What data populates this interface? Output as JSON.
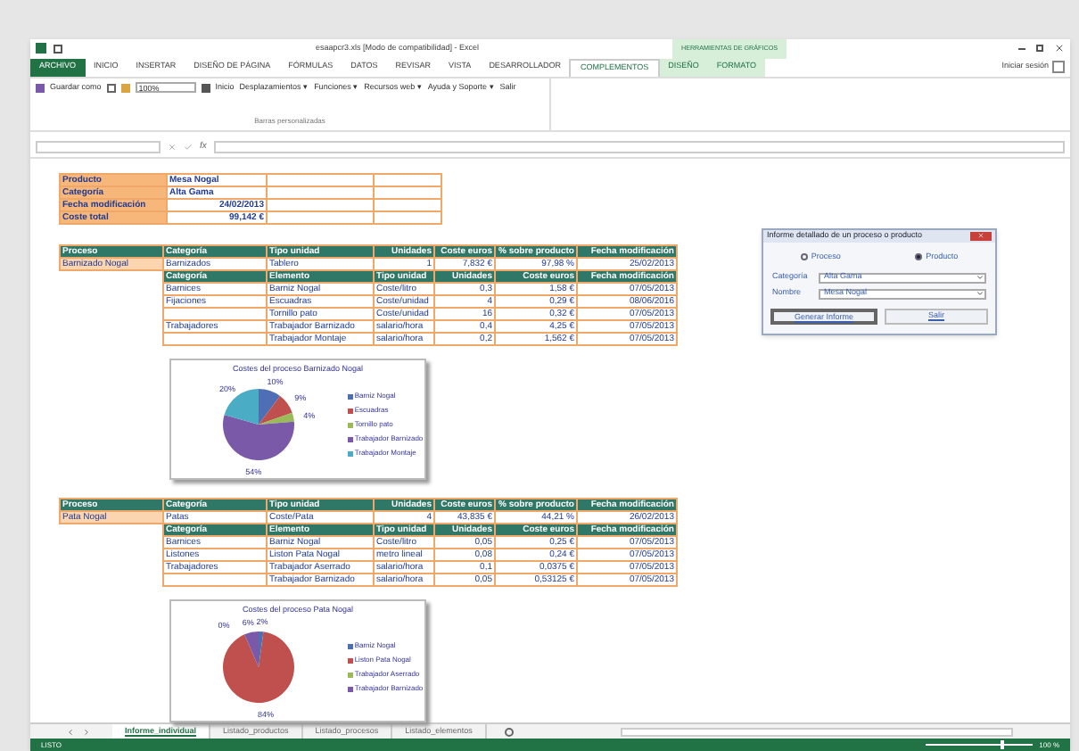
{
  "window": {
    "title": "esaapcr3.xls [Modo de compatibilidad] - Excel",
    "user": "Iniciar sesión"
  },
  "context_group": "HERRAMIENTAS DE GRÁFICOS",
  "tabs": [
    {
      "label": "ARCHIVO",
      "kind": "file",
      "selected": false
    },
    {
      "label": "INICIO",
      "kind": "tab",
      "selected": false
    },
    {
      "label": "INSERTAR",
      "kind": "tab",
      "selected": false
    },
    {
      "label": "DISEÑO DE PÁGINA",
      "kind": "tab",
      "selected": false
    },
    {
      "label": "FÓRMULAS",
      "kind": "tab",
      "selected": false
    },
    {
      "label": "DATOS",
      "kind": "tab",
      "selected": false
    },
    {
      "label": "REVISAR",
      "kind": "tab",
      "selected": false
    },
    {
      "label": "VISTA",
      "kind": "tab",
      "selected": false
    },
    {
      "label": "DESARROLLADOR",
      "kind": "tab",
      "selected": false
    },
    {
      "label": "COMPLEMENTOS",
      "kind": "tab",
      "selected": true
    },
    {
      "label": "DISEÑO",
      "kind": "context",
      "selected": false
    },
    {
      "label": "FORMATO",
      "kind": "context",
      "selected": false
    }
  ],
  "toolbar": {
    "save_as": "Guardar como",
    "zoom": "100%",
    "menus": [
      "Inicio",
      "Desplazamientos ▾",
      "Funciones ▾",
      "Recursos web ▾",
      "Ayuda y Soporte ▾",
      "Salir"
    ],
    "group_label": "Barras personalizadas"
  },
  "summary": [
    [
      "Producto",
      "Mesa Nogal"
    ],
    [
      "Categoría",
      "Alta Gama"
    ],
    [
      "Fecha modificación",
      "24/02/2013"
    ],
    [
      "Coste total",
      "99,142 €"
    ]
  ],
  "processes": [
    {
      "columns": [
        "Proceso",
        "Categoría",
        "Tipo unidad",
        "Unidades",
        "Coste euros",
        "% sobre producto",
        "Fecha modificación"
      ],
      "row": [
        "Barnizado Nogal",
        "Barnizados",
        "Tablero",
        "1",
        "7,832 €",
        "97,98 %",
        "25/02/2013"
      ],
      "sub_columns": [
        "Categoría",
        "Elemento",
        "Tipo unidad",
        "Unidades",
        "Coste euros",
        "Fecha modificación"
      ],
      "sub_rows": [
        [
          "Barnices",
          "Barniz Nogal",
          "Coste/litro",
          "0,3",
          "1,58 €",
          "07/05/2013"
        ],
        [
          "Fijaciones",
          "Escuadras",
          "Coste/unidad",
          "4",
          "0,29 €",
          "08/06/2016"
        ],
        [
          "",
          "Tornillo pato",
          "Coste/unidad",
          "16",
          "0,32 €",
          "07/05/2013"
        ],
        [
          "Trabajadores",
          "Trabajador Barnizado",
          "salario/hora",
          "0,4",
          "4,25 €",
          "07/05/2013"
        ],
        [
          "",
          "Trabajador Montaje",
          "salario/hora",
          "0,2",
          "1,562 €",
          "07/05/2013"
        ]
      ],
      "chart_data": {
        "type": "pie",
        "title": "Costes del proceso Barnizado Nogal",
        "categories": [
          "Barniz Nogal",
          "Escuadras",
          "Tornillo pato",
          "Trabajador Barnizado",
          "Trabajador Montaje"
        ],
        "values": [
          10,
          9,
          4,
          54,
          20
        ],
        "value_labels": [
          "10%",
          "9%",
          "4%",
          "54%",
          "20%"
        ],
        "data_labels": true,
        "legend": "right"
      }
    },
    {
      "columns": [
        "Proceso",
        "Categoría",
        "Tipo unidad",
        "Unidades",
        "Coste euros",
        "% sobre producto",
        "Fecha modificación"
      ],
      "row": [
        "Pata Nogal",
        "Patas",
        "Coste/Pata",
        "4",
        "43,835 €",
        "44,21 %",
        "26/02/2013"
      ],
      "sub_columns": [
        "Categoría",
        "Elemento",
        "Tipo unidad",
        "Unidades",
        "Coste euros",
        "Fecha modificación"
      ],
      "sub_rows": [
        [
          "Barnices",
          "Barniz Nogal",
          "Coste/litro",
          "0,05",
          "0,25 €",
          "07/05/2013"
        ],
        [
          "Listones",
          "Liston Pata Nogal",
          "metro lineal",
          "0,08",
          "0,24 €",
          "07/05/2013"
        ],
        [
          "Trabajadores",
          "Trabajador Aserrado",
          "salario/hora",
          "0,1",
          "0,0375 €",
          "07/05/2013"
        ],
        [
          "",
          "Trabajador Barnizado",
          "salario/hora",
          "0,05",
          "0,53125 €",
          "07/05/2013"
        ]
      ],
      "chart_data": {
        "type": "pie",
        "title": "Costes del proceso Pata Nogal",
        "categories": [
          "Barniz Nogal",
          "Liston Pata Nogal",
          "Trabajador Aserrado",
          "Trabajador Barnizado"
        ],
        "values": [
          2,
          84,
          0,
          6
        ],
        "value_labels": [
          "2%",
          "84%",
          "0%",
          "6%"
        ],
        "data_labels": true,
        "legend": "right"
      }
    }
  ],
  "dialog": {
    "title": "Informe detallado de un proceso o producto",
    "options": [
      {
        "label": "Proceso",
        "selected": false
      },
      {
        "label": "Producto",
        "selected": true
      }
    ],
    "fields": [
      {
        "label": "Categoría",
        "value": "Alta Gama"
      },
      {
        "label": "Nombre",
        "value": "Mesa Nogal"
      }
    ],
    "buttons": [
      "Generar Informe",
      "Salir"
    ]
  },
  "sheets": [
    {
      "label": "Informe_individual",
      "selected": true
    },
    {
      "label": "Listado_productos",
      "selected": false
    },
    {
      "label": "Listado_procesos",
      "selected": false
    },
    {
      "label": "Listado_elementos",
      "selected": false
    }
  ],
  "formula_bar": {
    "function_label": "fx"
  },
  "status_bar": {
    "state": "LISTO",
    "zoom": "100 %",
    "level": 0.7
  }
}
